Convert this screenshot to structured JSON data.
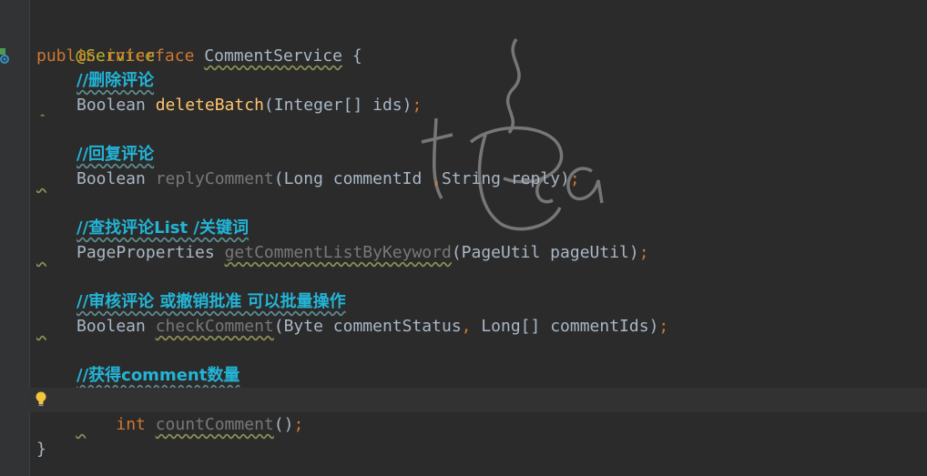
{
  "code": {
    "annotation": "@Service",
    "interface_decl": {
      "kw_public": "public",
      "kw_interface": "interface",
      "name": "CommentService",
      "open_brace": "{"
    },
    "methods": [
      {
        "comment": "//删除评论",
        "return_type": "Boolean",
        "name": "deleteBatch",
        "params": "(Integer[] ids)",
        "semicolon": ";"
      },
      {
        "comment": "//回复评论",
        "return_type": "Boolean",
        "name": "replyComment",
        "param_open": "(Long commentId ",
        "param_comma": ",",
        "param_rest": "String reply)",
        "semicolon": ";"
      },
      {
        "comment": "//查找评论List /关键词",
        "return_type": "PageProperties",
        "name": "getCommentListByKeyword",
        "params": "(PageUtil pageUtil)",
        "semicolon": ";"
      },
      {
        "comment": "//审核评论 或撤销批准 可以批量操作",
        "return_type": "Boolean",
        "name": "checkComment",
        "param_open": "(Byte commentStatus",
        "param_comma": ",",
        "param_rest": " Long[] commentIds)",
        "semicolon": ";"
      },
      {
        "comment": "//获得comment数量",
        "return_type": "int",
        "name": "countComment",
        "params": "()",
        "semicolon": ";"
      }
    ],
    "close_brace": "}"
  },
  "icons": {
    "gutter": "implementation-gutter-icon",
    "intention": "lightbulb-icon",
    "watermark": "tea-cup-watermark"
  },
  "colors": {
    "background": "#2b2b2b",
    "keyword": "#cc7832",
    "annotation": "#bbb529",
    "method_declaration": "#ffc66d",
    "unused_method": "#787878",
    "comment": "#23b4d6",
    "text": "#a9b7c6"
  }
}
